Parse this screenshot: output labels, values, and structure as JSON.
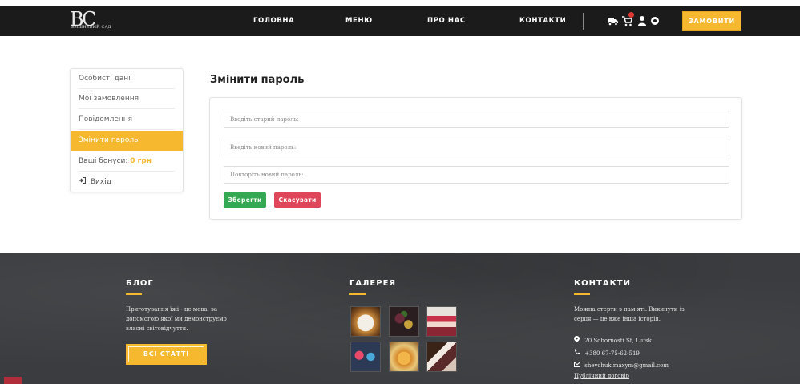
{
  "header": {
    "logo": {
      "mark": "BC",
      "text": "ВИШНЕВИЙ САД"
    },
    "nav": [
      "ГОЛОВНА",
      "МЕНЮ",
      "ПРО НАС",
      "КОНТАКТИ"
    ],
    "icons": [
      "truck-icon",
      "cart-icon",
      "user-icon",
      "settings-icon"
    ],
    "order_label": "ЗАМОВИТИ"
  },
  "sidebar": {
    "items": [
      "Особисті дані",
      "Мої замовлення",
      "Повідомлення",
      "Змінити пароль"
    ],
    "bonus_label": "Ваші бонуси:",
    "bonus_value": "0 грн",
    "logout_label": "Вихід"
  },
  "main": {
    "title": "Змінити пароль",
    "fields": {
      "old_placeholder": "Введіть старий пароль:",
      "new_placeholder": "Введіть новий пароль:",
      "repeat_placeholder": "Повторіть новий пароль:"
    },
    "save_label": "Зберегти",
    "cancel_label": "Скасувати"
  },
  "footer": {
    "blog": {
      "title": "БЛОГ",
      "lines": [
        "Приготування їжі - це мова, за",
        "допомогою якої ми демонструємо",
        "власні світовідчуття."
      ],
      "button_label": "ВСІ СТАТТІ"
    },
    "gallery": {
      "title": "ГАЛЕРЕЯ"
    },
    "contacts": {
      "title": "КОНТАКТИ",
      "lines": [
        "Можна стерти з пам'яті. Викинути із",
        "серця — це вже інша історія."
      ],
      "address": "20 Sobornosti St, Lutsk",
      "phone": "+380 67-75-62-519",
      "email": "shevchuk.maxym@gmail.com",
      "contract_link": "Публічний договір"
    }
  },
  "colors": {
    "accent": "#f5b82e",
    "header_bg": "#1b1b1b",
    "footer_bg": "#3a3c3f",
    "save": "#35a853",
    "cancel": "#e0465a"
  }
}
